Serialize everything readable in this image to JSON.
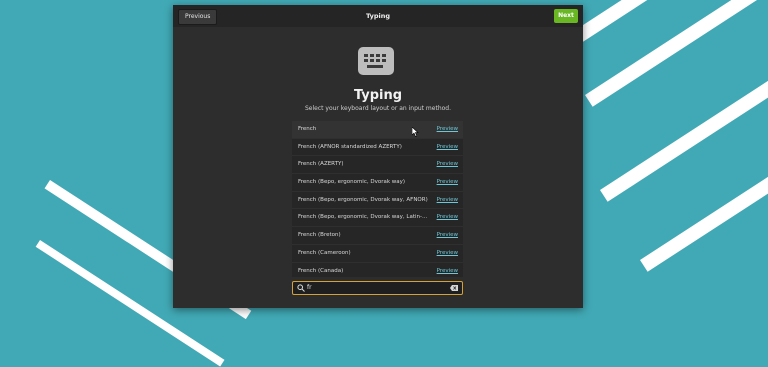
{
  "header": {
    "previous_label": "Previous",
    "title": "Typing",
    "next_label": "Next"
  },
  "main": {
    "heading": "Typing",
    "subtitle": "Select your keyboard layout or an input method.",
    "icon": "keyboard-icon"
  },
  "layouts": [
    {
      "label": "French",
      "preview": "Preview"
    },
    {
      "label": "French (AFNOR standardized AZERTY)",
      "preview": "Preview"
    },
    {
      "label": "French (AZERTY)",
      "preview": "Preview"
    },
    {
      "label": "French (Bepo, ergonomic, Dvorak way)",
      "preview": "Preview"
    },
    {
      "label": "French (Bepo, ergonomic, Dvorak way, AFNOR)",
      "preview": "Preview"
    },
    {
      "label": "French (Bepo, ergonomic, Dvorak way, Latin-...",
      "preview": "Preview"
    },
    {
      "label": "French (Breton)",
      "preview": "Preview"
    },
    {
      "label": "French (Cameroon)",
      "preview": "Preview"
    },
    {
      "label": "French (Canada)",
      "preview": "Preview"
    }
  ],
  "search": {
    "value": "fr",
    "icon": "search-icon",
    "clear_icon": "clear-icon"
  },
  "colors": {
    "background": "#41a9b5",
    "accent_next": "#68b723",
    "link": "#6ec7d6",
    "search_focus": "#d4a23a"
  }
}
